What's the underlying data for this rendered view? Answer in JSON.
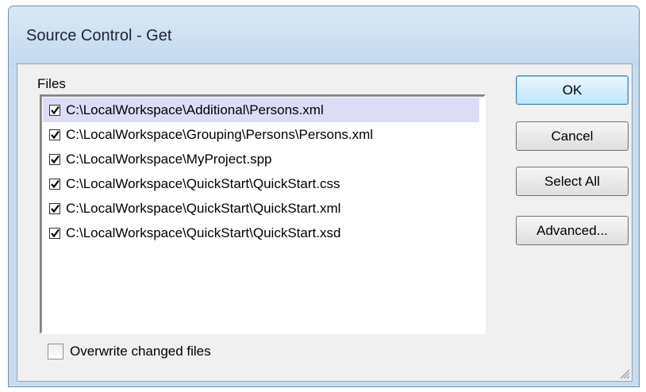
{
  "window": {
    "title": "Source Control - Get"
  },
  "files": {
    "label": "Files",
    "items": [
      {
        "path": "C:\\LocalWorkspace\\Additional\\Persons.xml",
        "checked": true,
        "selected": true
      },
      {
        "path": "C:\\LocalWorkspace\\Grouping\\Persons\\Persons.xml",
        "checked": true,
        "selected": false
      },
      {
        "path": "C:\\LocalWorkspace\\MyProject.spp",
        "checked": true,
        "selected": false
      },
      {
        "path": "C:\\LocalWorkspace\\QuickStart\\QuickStart.css",
        "checked": true,
        "selected": false
      },
      {
        "path": "C:\\LocalWorkspace\\QuickStart\\QuickStart.xml",
        "checked": true,
        "selected": false
      },
      {
        "path": "C:\\LocalWorkspace\\QuickStart\\QuickStart.xsd",
        "checked": true,
        "selected": false
      }
    ]
  },
  "buttons": {
    "ok": "OK",
    "cancel": "Cancel",
    "select_all": "Select All",
    "advanced": "Advanced..."
  },
  "options": {
    "overwrite_label": "Overwrite changed files",
    "overwrite_checked": false
  },
  "colors": {
    "titlebar": "#c8dced",
    "selected_row": "#dcdcf6",
    "default_button_border": "#3c7fb1"
  }
}
